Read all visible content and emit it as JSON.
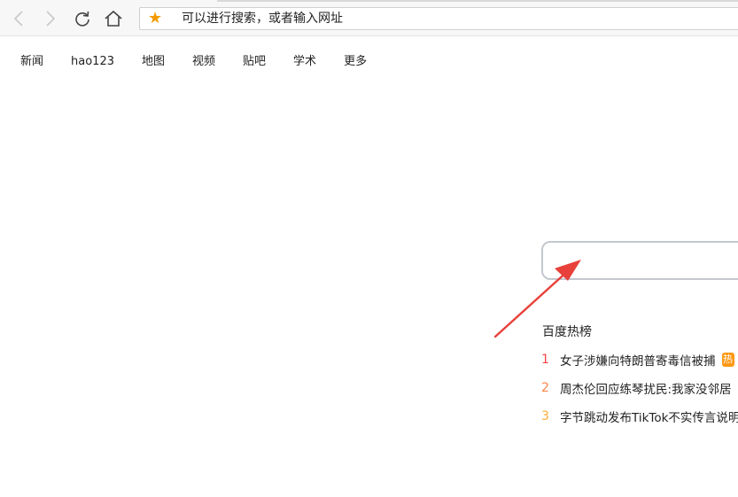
{
  "browser": {
    "address_placeholder": "可以进行搜索，或者输入网址",
    "icons": {
      "back": "back-arrow-icon",
      "forward": "forward-arrow-icon",
      "reload": "reload-icon",
      "home": "home-icon",
      "bookmark": "star-icon"
    },
    "bookmark_color": "#f29b00"
  },
  "nav": {
    "items": [
      {
        "label": "新闻"
      },
      {
        "label": "hao123"
      },
      {
        "label": "地图"
      },
      {
        "label": "视频"
      },
      {
        "label": "贴吧"
      },
      {
        "label": "学术"
      },
      {
        "label": "更多"
      }
    ]
  },
  "search": {
    "value": ""
  },
  "annotation": {
    "type": "arrow",
    "color": "#e8403a"
  },
  "hot": {
    "title": "百度热榜",
    "items": [
      {
        "rank": "1",
        "text": "女子涉嫌向特朗普寄毒信被捕",
        "badge": "热",
        "rank_color": "#f54545"
      },
      {
        "rank": "2",
        "text": "周杰伦回应练琴扰民:我家没邻居",
        "badge": "",
        "rank_color": "#ff8547"
      },
      {
        "rank": "3",
        "text": "字节跳动发布TikTok不实传言说明",
        "badge": "",
        "rank_color": "#ffac38"
      }
    ]
  }
}
